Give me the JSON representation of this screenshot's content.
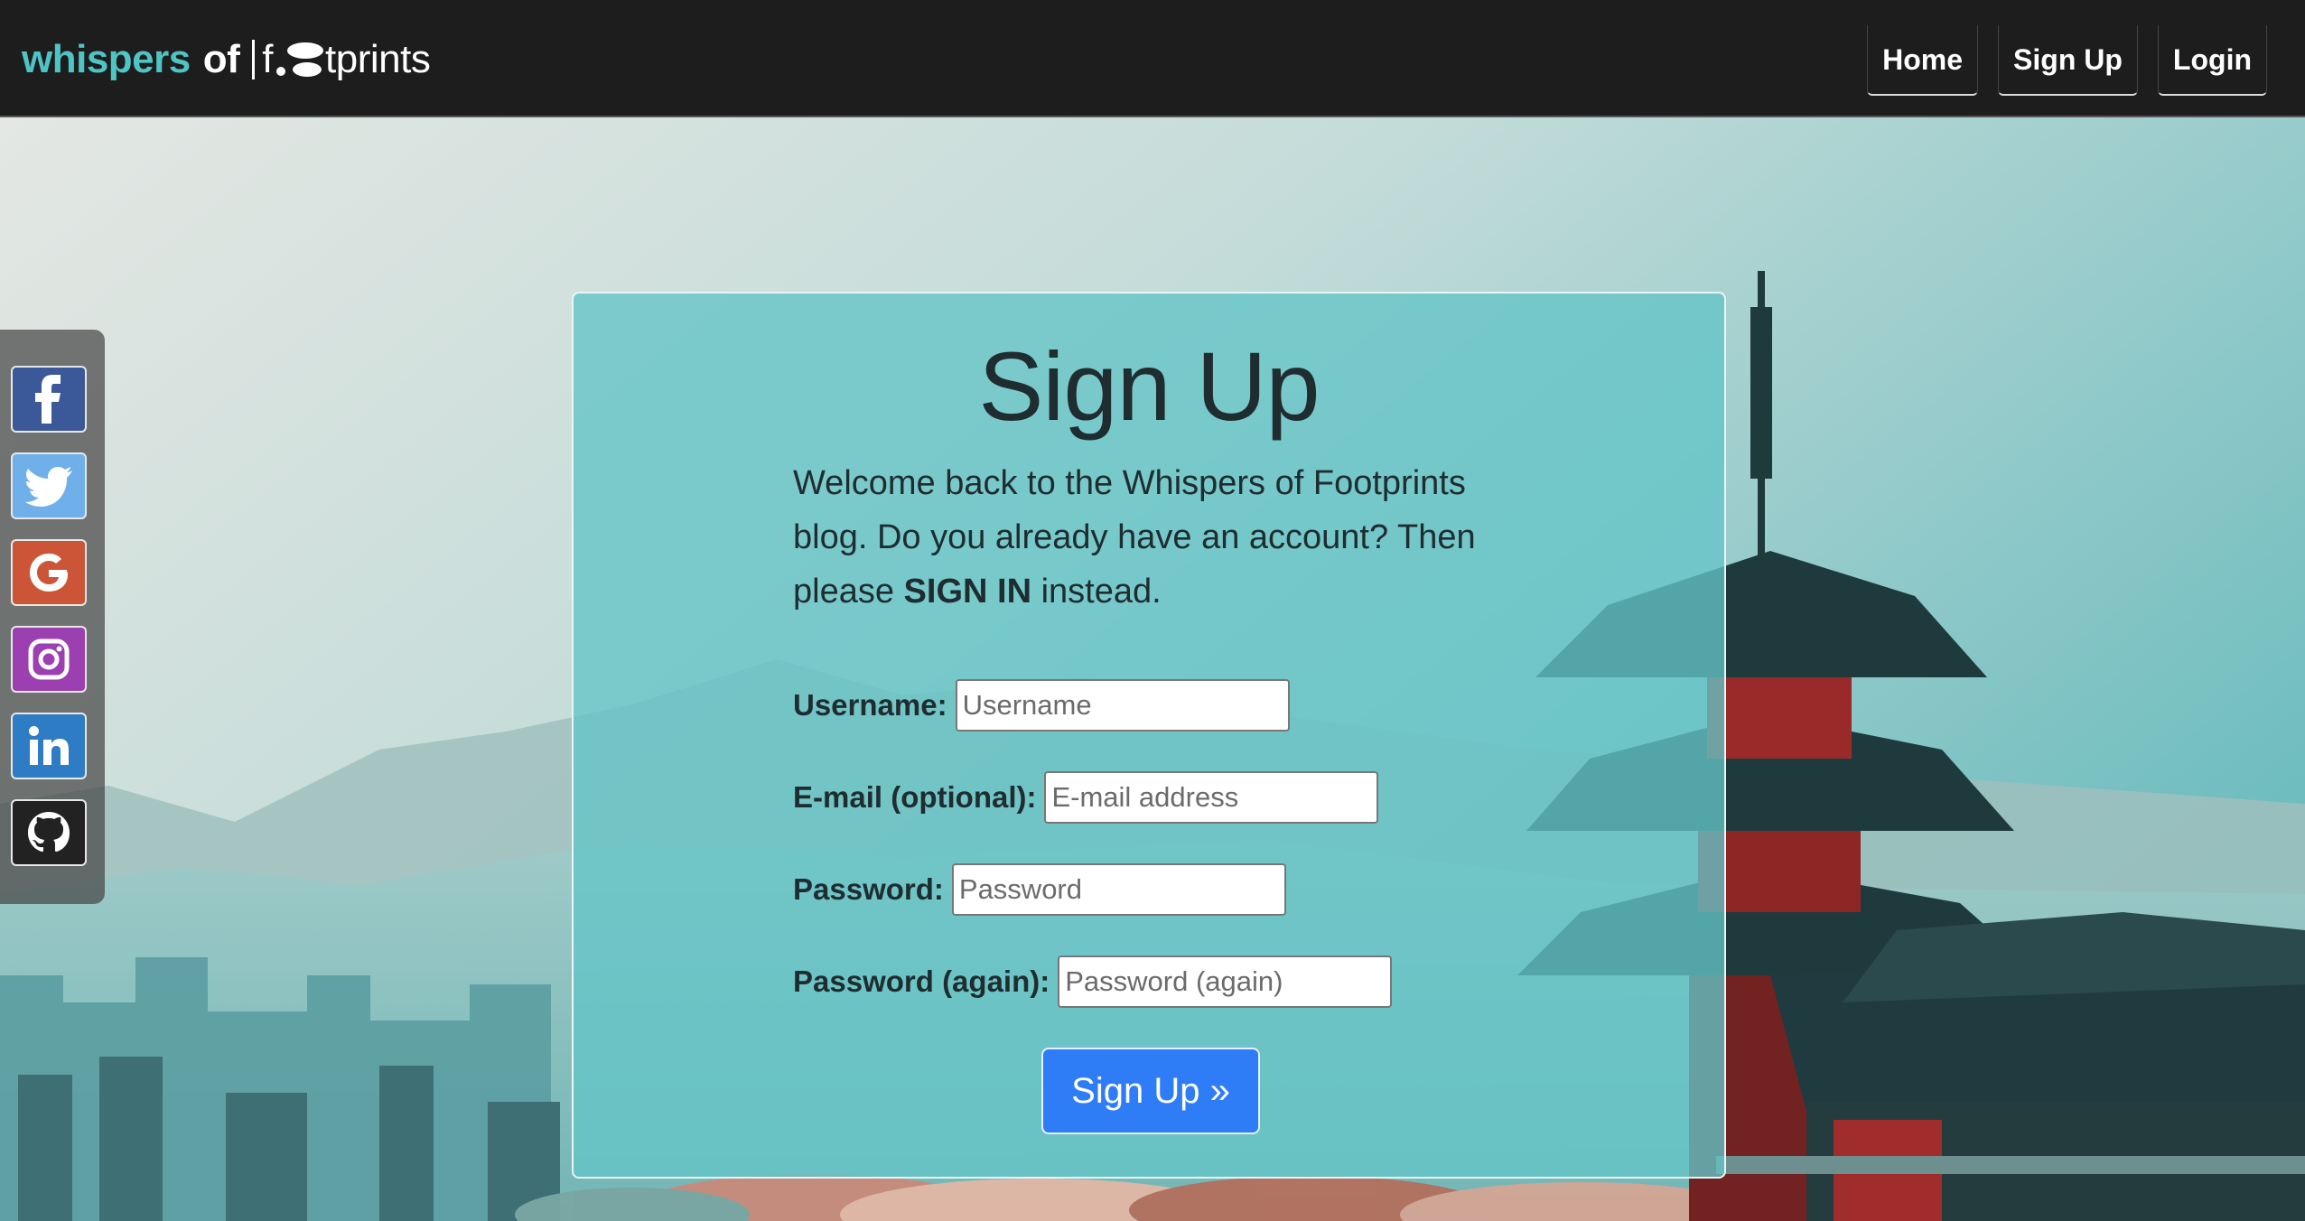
{
  "brand": {
    "whispers": "whispers",
    "of": "of",
    "foot_prefix": "f",
    "foot_suffix": "tprints"
  },
  "nav": {
    "home": "Home",
    "signup": "Sign Up",
    "login": "Login"
  },
  "social": [
    "facebook-icon",
    "twitter-icon",
    "google-icon",
    "instagram-icon",
    "linkedin-icon",
    "github-icon"
  ],
  "colors": {
    "accent": "#4fc4c4",
    "button": "#2e7cf6",
    "navbar": "#1d1d1d"
  },
  "form": {
    "title": "Sign Up",
    "intro_text": "Welcome back to the Whispers of Footprints blog. Do you already have an account? Then please",
    "intro_link": "SIGN IN",
    "intro_tail": "instead.",
    "username_label": "Username:",
    "username_placeholder": "Username",
    "email_label": "E-mail (optional):",
    "email_placeholder": "E-mail address",
    "password_label": "Password:",
    "password_placeholder": "Password",
    "password2_label": "Password (again):",
    "password2_placeholder": "Password (again)",
    "submit_label": "Sign Up »"
  }
}
